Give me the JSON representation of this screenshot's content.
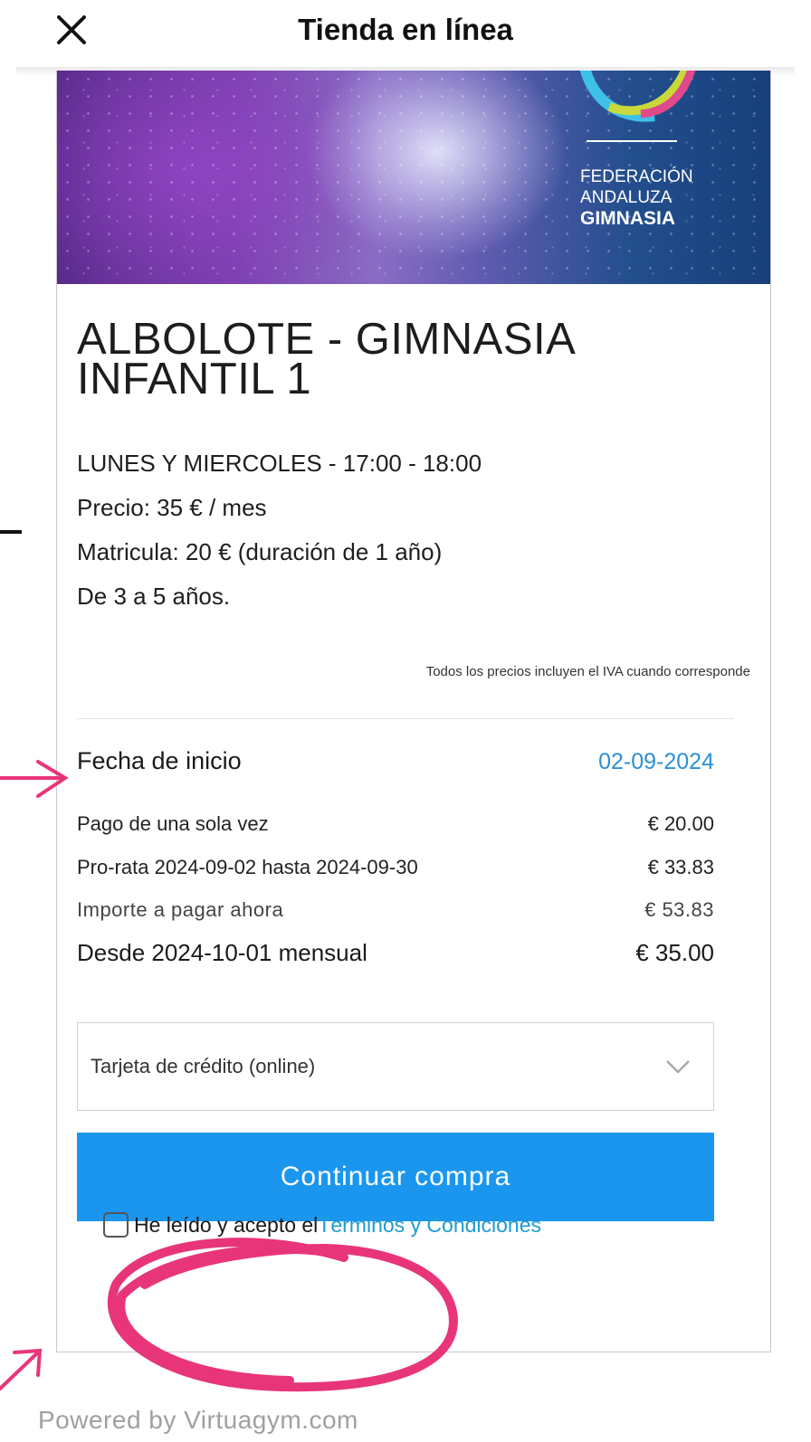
{
  "header": {
    "title": "Tienda en línea",
    "close_icon": "close-icon"
  },
  "banner": {
    "logo_line1": "FEDERACIÓN",
    "logo_line2": "ANDALUZA",
    "logo_line3": "GIMNASIA"
  },
  "product": {
    "title": "ALBOLOTE - GIMNASIA INFANTIL 1",
    "schedule": "LUNES Y MIERCOLES - 17:00 - 18:00",
    "price": "Precio: 35 € / mes",
    "enrollment": "Matricula: 20 € (duración de 1 año)",
    "ages": "De 3 a 5 años.",
    "tax_note": "Todos los precios incluyen el IVA cuando corresponde"
  },
  "summary": {
    "start_label": "Fecha de inicio",
    "start_value": "02-09-2024",
    "one_time_label": "Pago de una sola vez",
    "one_time_value": "€ 20.00",
    "prorata_label": "Pro-rata 2024-09-02 hasta 2024-09-30",
    "prorata_value": "€ 33.83",
    "pay_now_label": "Importe a pagar ahora",
    "pay_now_value": "€ 53.83",
    "monthly_label": "Desde 2024-10-01 mensual",
    "monthly_value": "€ 35.00"
  },
  "payment": {
    "selected": "Tarjeta de crédito (online)"
  },
  "actions": {
    "continue_label": "Continuar compra"
  },
  "terms": {
    "text": "He leído y acepto el ",
    "link": "Términos y Condiciones",
    "checked": false
  },
  "footer": {
    "powered": "Powered by Virtuagym.com"
  },
  "colors": {
    "accent": "#1a96ef",
    "link": "#1e9bd4",
    "annotation": "#e8357a"
  }
}
